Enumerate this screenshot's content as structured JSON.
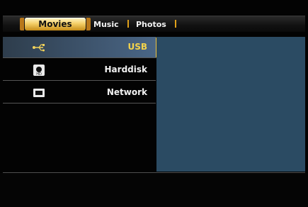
{
  "tabs": {
    "movies": "Movies",
    "music": "Music",
    "photos": "Photos"
  },
  "sources": [
    {
      "label": "USB",
      "icon": "usb-icon",
      "selected": true
    },
    {
      "label": "Harddisk",
      "icon": "harddisk-icon",
      "selected": false
    },
    {
      "label": "Network",
      "icon": "network-icon",
      "selected": false
    }
  ],
  "colors": {
    "accent": "#f4d34b",
    "panel": "#2b4b63"
  }
}
